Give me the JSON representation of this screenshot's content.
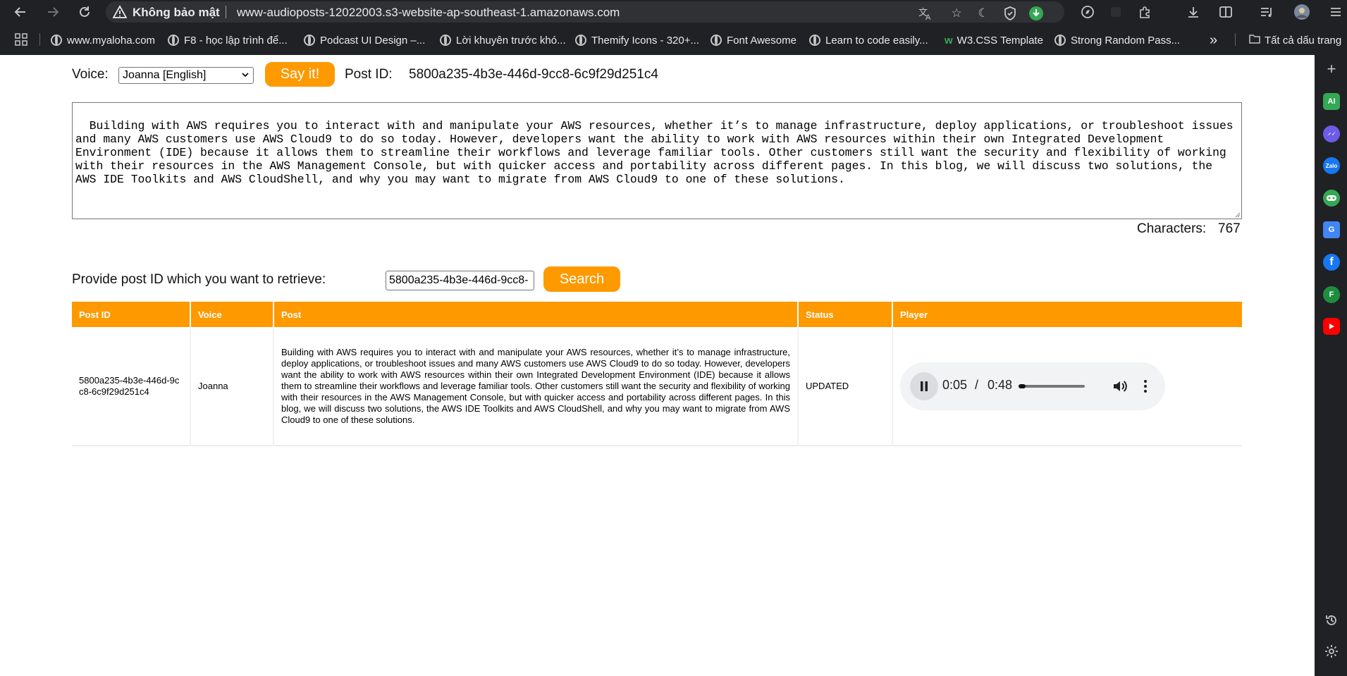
{
  "browser": {
    "security_label": "Không bảo mật",
    "url": "www-audioposts-12022003.s3-website-ap-southeast-1.amazonaws.com"
  },
  "bookmarks": {
    "items": [
      "www.myaloha.com",
      "F8 - học lập trình để...",
      "Podcast UI Design –...",
      "Lời khuyên trước khó...",
      "Themify Icons - 320+...",
      "Font Awesome",
      "Learn to code easily...",
      "W3.CSS Template",
      "Strong Random Pass..."
    ],
    "overflow": "»",
    "all_bookmarks": "Tất cả dấu trang"
  },
  "side_panel": {
    "icons": [
      "AI",
      "messenger",
      "Zalo",
      "game",
      "G",
      "f",
      "F",
      "youtube"
    ]
  },
  "form": {
    "voice_label": "Voice:",
    "voice_selected": "Joanna [English]",
    "say_button": "Say it!",
    "post_id_label": "Post  ID:",
    "post_id_value": "5800a235-4b3e-446d-9cc8-6c9f29d251c4",
    "post_text": "Building with AWS requires you to interact with and manipulate your AWS resources, whether it’s to manage infrastructure, deploy applications, or troubleshoot issues and many AWS customers use AWS Cloud9 to do so today. However, developers want the ability to work with AWS resources within their own Integrated Development Environment (IDE) because it allows them to streamline their workflows and leverage familiar tools. Other customers still want the security and flexibility of working with their resources in the AWS Management Console, but with quicker access and portability across different pages. In this blog, we will discuss two solutions, the AWS IDE Toolkits and AWS CloudShell, and why you may want to migrate from AWS Cloud9 to one of these solutions.",
    "characters_label": "Characters:",
    "characters_count": "767"
  },
  "retrieve": {
    "label": "Provide  post  ID  which  you  want  to  retrieve:",
    "input_value": "5800a235-4b3e-446d-9cc8-",
    "search_button": "Search"
  },
  "table": {
    "headers": [
      "Post  ID",
      "Voice",
      "Post",
      "Status",
      "Player"
    ],
    "row": {
      "post_id": "5800a235-4b3e-446d-9cc8-6c9f29d251c4",
      "voice": "Joanna",
      "post": "Building with AWS requires you to interact with and manipulate your AWS resources, whether it’s to manage infrastructure, deploy applications, or troubleshoot issues and many AWS customers use AWS Cloud9 to do so today. However, developers want the ability to work with AWS resources within their own Integrated Development Environment (IDE) because it allows them to streamline their workflows and leverage familiar tools. Other customers still want the security and flexibility of working with their resources in the AWS Management Console, but with quicker access and portability across different pages. In this blog, we will discuss two solutions, the AWS IDE Toolkits and AWS CloudShell, and why you may want to migrate from AWS Cloud9 to one of these solutions.",
      "status": "UPDATED"
    }
  },
  "player": {
    "current_time": "0:05",
    "separator": "/",
    "duration": "0:48",
    "progress": 0.104
  },
  "colors": {
    "accent": "#ff9900",
    "chrome_bg": "#202124",
    "page_bg": "#ffffff"
  }
}
